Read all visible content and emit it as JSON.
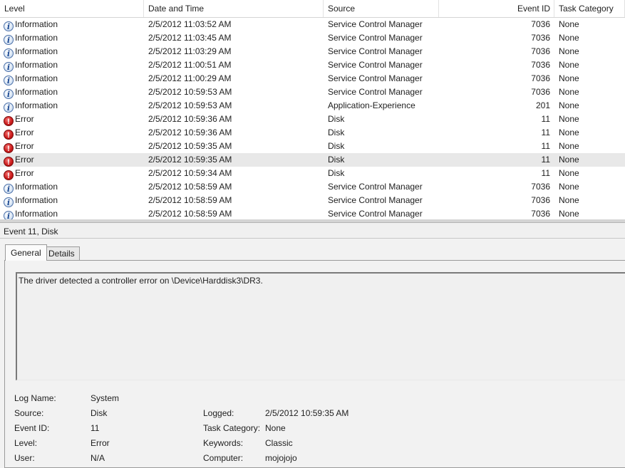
{
  "columns": {
    "level": "Level",
    "datetime": "Date and Time",
    "source": "Source",
    "event_id": "Event ID",
    "task_category": "Task Category"
  },
  "events": [
    {
      "icon": "information-icon",
      "level": "Information",
      "datetime": "2/5/2012 11:03:52 AM",
      "source": "Service Control Manager",
      "event_id": "7036",
      "category": "None"
    },
    {
      "icon": "information-icon",
      "level": "Information",
      "datetime": "2/5/2012 11:03:45 AM",
      "source": "Service Control Manager",
      "event_id": "7036",
      "category": "None"
    },
    {
      "icon": "information-icon",
      "level": "Information",
      "datetime": "2/5/2012 11:03:29 AM",
      "source": "Service Control Manager",
      "event_id": "7036",
      "category": "None"
    },
    {
      "icon": "information-icon",
      "level": "Information",
      "datetime": "2/5/2012 11:00:51 AM",
      "source": "Service Control Manager",
      "event_id": "7036",
      "category": "None"
    },
    {
      "icon": "information-icon",
      "level": "Information",
      "datetime": "2/5/2012 11:00:29 AM",
      "source": "Service Control Manager",
      "event_id": "7036",
      "category": "None"
    },
    {
      "icon": "information-icon",
      "level": "Information",
      "datetime": "2/5/2012 10:59:53 AM",
      "source": "Service Control Manager",
      "event_id": "7036",
      "category": "None"
    },
    {
      "icon": "information-icon",
      "level": "Information",
      "datetime": "2/5/2012 10:59:53 AM",
      "source": "Application-Experience",
      "event_id": "201",
      "category": "None"
    },
    {
      "icon": "error-icon",
      "level": "Error",
      "datetime": "2/5/2012 10:59:36 AM",
      "source": "Disk",
      "event_id": "11",
      "category": "None"
    },
    {
      "icon": "error-icon",
      "level": "Error",
      "datetime": "2/5/2012 10:59:36 AM",
      "source": "Disk",
      "event_id": "11",
      "category": "None"
    },
    {
      "icon": "error-icon",
      "level": "Error",
      "datetime": "2/5/2012 10:59:35 AM",
      "source": "Disk",
      "event_id": "11",
      "category": "None"
    },
    {
      "icon": "error-icon",
      "level": "Error",
      "datetime": "2/5/2012 10:59:35 AM",
      "source": "Disk",
      "event_id": "11",
      "category": "None",
      "selected": true
    },
    {
      "icon": "error-icon",
      "level": "Error",
      "datetime": "2/5/2012 10:59:34 AM",
      "source": "Disk",
      "event_id": "11",
      "category": "None"
    },
    {
      "icon": "information-icon",
      "level": "Information",
      "datetime": "2/5/2012 10:58:59 AM",
      "source": "Service Control Manager",
      "event_id": "7036",
      "category": "None"
    },
    {
      "icon": "information-icon",
      "level": "Information",
      "datetime": "2/5/2012 10:58:59 AM",
      "source": "Service Control Manager",
      "event_id": "7036",
      "category": "None"
    },
    {
      "icon": "information-icon",
      "level": "Information",
      "datetime": "2/5/2012 10:58:59 AM",
      "source": "Service Control Manager",
      "event_id": "7036",
      "category": "None"
    }
  ],
  "preview": {
    "title": "Event 11, Disk",
    "tabs": {
      "general": "General",
      "details": "Details"
    },
    "description": "The driver detected a controller error on \\Device\\Harddisk3\\DR3.",
    "labels": {
      "log_name": "Log Name:",
      "source": "Source:",
      "event_id": "Event ID:",
      "level": "Level:",
      "user": "User:",
      "logged": "Logged:",
      "task_category": "Task Category:",
      "keywords": "Keywords:",
      "computer": "Computer:"
    },
    "values": {
      "log_name": "System",
      "source": "Disk",
      "event_id": "11",
      "level": "Error",
      "user": "N/A",
      "logged": "2/5/2012 10:59:35 AM",
      "task_category": "None",
      "keywords": "Classic",
      "computer": "mojojojo"
    }
  },
  "colors": {
    "selected_row": "#e8e8e8",
    "error_icon": "#cf1e1e",
    "info_icon": "#1d4a93"
  }
}
